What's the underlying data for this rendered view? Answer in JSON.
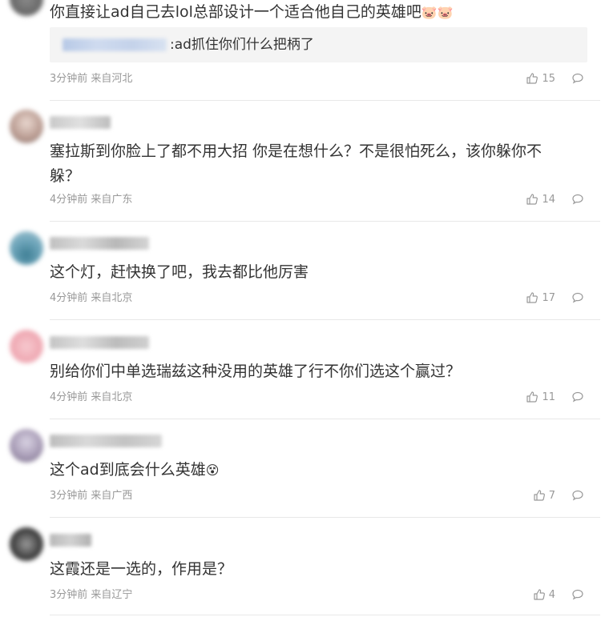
{
  "comments": [
    {
      "content": "你直接让ad自己去lol总部设计一个适合他自己的英雄吧",
      "emoji": "🐷🐷",
      "quote": {
        "text": ":ad抓住你们什么把柄了"
      },
      "time_location": "3分钟前 来自河北",
      "likes": "15"
    },
    {
      "content_line1": "塞拉斯到你脸上了都不用大招 你是在想什么？不是很怕死么，该你躲你不",
      "content_line2": "躲？",
      "time_location": "4分钟前 来自广东",
      "likes": "14"
    },
    {
      "content": "这个灯，赶快换了吧，我去都比他厉害",
      "time_location": "4分钟前 来自北京",
      "likes": "17"
    },
    {
      "content": "别给你们中单选瑞兹这种没用的英雄了行不你们选这个赢过？",
      "time_location": "4分钟前 来自北京",
      "likes": "11"
    },
    {
      "content": "这个ad到底会什么英雄",
      "emoji": "😵",
      "time_location": "3分钟前 来自广西",
      "likes": "7"
    },
    {
      "content": "这霞还是一选的，作用是？",
      "time_location": "3分钟前 来自辽宁",
      "likes": "4"
    }
  ]
}
